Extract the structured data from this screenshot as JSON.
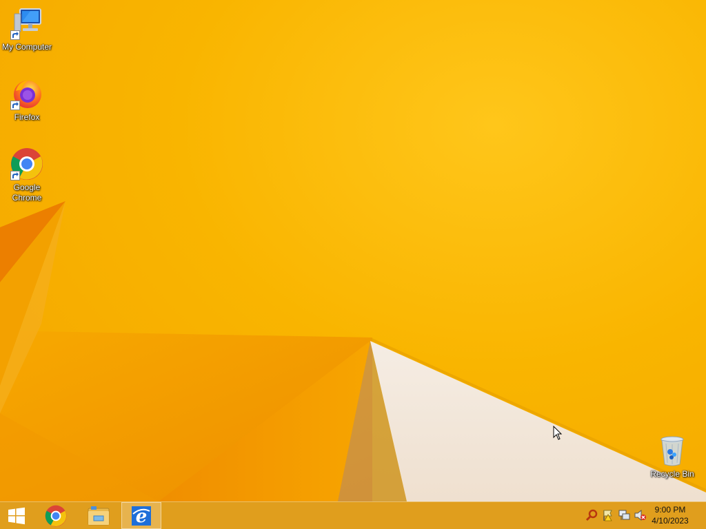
{
  "desktop": {
    "icons": [
      {
        "label": "My Computer",
        "icon": "computer-icon"
      },
      {
        "label": "Firefox",
        "icon": "firefox-icon"
      },
      {
        "label": "Google Chrome",
        "icon": "chrome-icon"
      },
      {
        "label": "Recycle Bin",
        "icon": "recycle-bin-icon"
      }
    ]
  },
  "taskbar": {
    "pinned": [
      {
        "name": "start",
        "icon": "windows-logo-icon"
      },
      {
        "name": "chrome",
        "icon": "chrome-icon"
      },
      {
        "name": "file-explorer",
        "icon": "folder-icon"
      },
      {
        "name": "internet-explorer",
        "icon": "ie-icon",
        "active": true
      }
    ],
    "tray": {
      "icons": [
        "search-icon",
        "action-center-flag-icon",
        "network-icon",
        "volume-muted-icon"
      ],
      "time": "9:00 PM",
      "date": "4/10/2023"
    }
  },
  "colors": {
    "wallpaper": "#f9b300",
    "wallpaper_shadow": "#ef8c00",
    "wallpaper_light": "#f3e6d6"
  }
}
